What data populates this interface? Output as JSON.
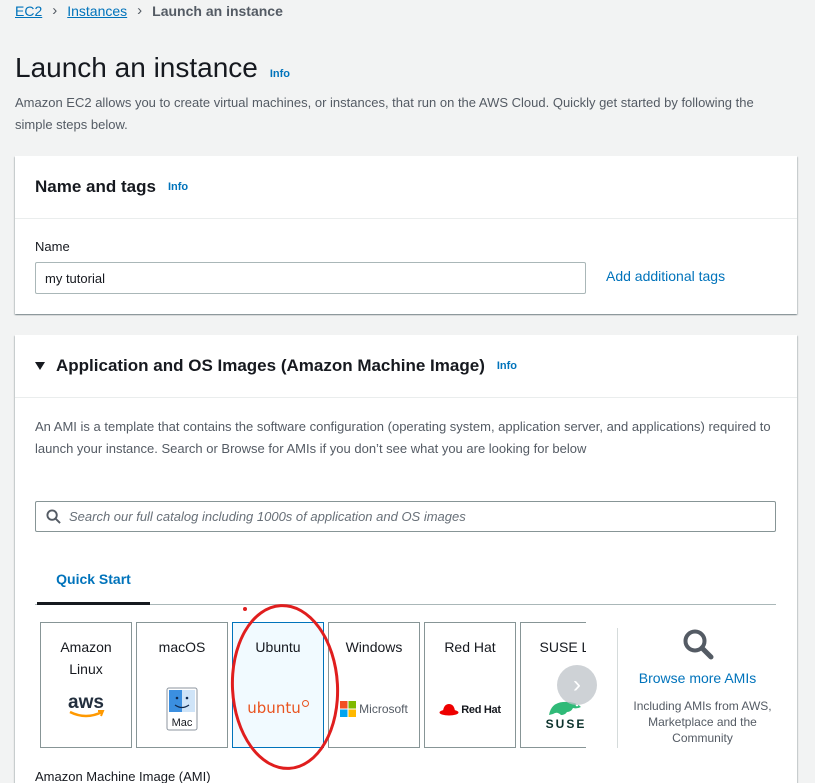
{
  "breadcrumb": {
    "root": "EC2",
    "instances": "Instances",
    "current": "Launch an instance"
  },
  "page": {
    "title": "Launch an instance",
    "info": "Info",
    "description": "Amazon EC2 allows you to create virtual machines, or instances, that run on the AWS Cloud. Quickly get started by following the simple steps below."
  },
  "name_tags": {
    "title": "Name and tags",
    "info": "Info",
    "name_label": "Name",
    "name_value": "my tutorial",
    "add_tags": "Add additional tags"
  },
  "ami": {
    "title": "Application and OS Images (Amazon Machine Image)",
    "info": "Info",
    "description": "An AMI is a template that contains the software configuration (operating system, application server, and applications) required to launch your instance. Search or Browse for AMIs if you don’t see what you are looking for below",
    "search_placeholder": "Search our full catalog including 1000s of application and OS images",
    "tab_quick_start": "Quick Start",
    "tiles": [
      {
        "label": "Amazon\nLinux",
        "logo_text": "aws"
      },
      {
        "label": "macOS",
        "logo_text": "Mac"
      },
      {
        "label": "Ubuntu",
        "logo_text": "ubuntu"
      },
      {
        "label": "Windows",
        "logo_text": "Microsoft"
      },
      {
        "label": "Red Hat",
        "logo_text": "Red Hat"
      },
      {
        "label": "SUSE Li",
        "logo_text": "SUSE"
      }
    ],
    "selected_tile": "Ubuntu",
    "browse_more": "Browse more AMIs",
    "browse_sub": "Including AMIs from AWS, Marketplace and the Community",
    "ami_label": "Amazon Machine Image (AMI)"
  },
  "colors": {
    "link": "#0073bb",
    "selected_bg": "#f1faff",
    "annotation": "#e01e1e",
    "ubuntu": "#e95420",
    "redhat": "#ee0000",
    "suse": "#30ba78"
  },
  "icons": {
    "breadcrumb_sep": "chevron-right-icon",
    "search": "search-icon",
    "carousel": "chevron-right-icon",
    "browse": "magnifier-icon"
  }
}
